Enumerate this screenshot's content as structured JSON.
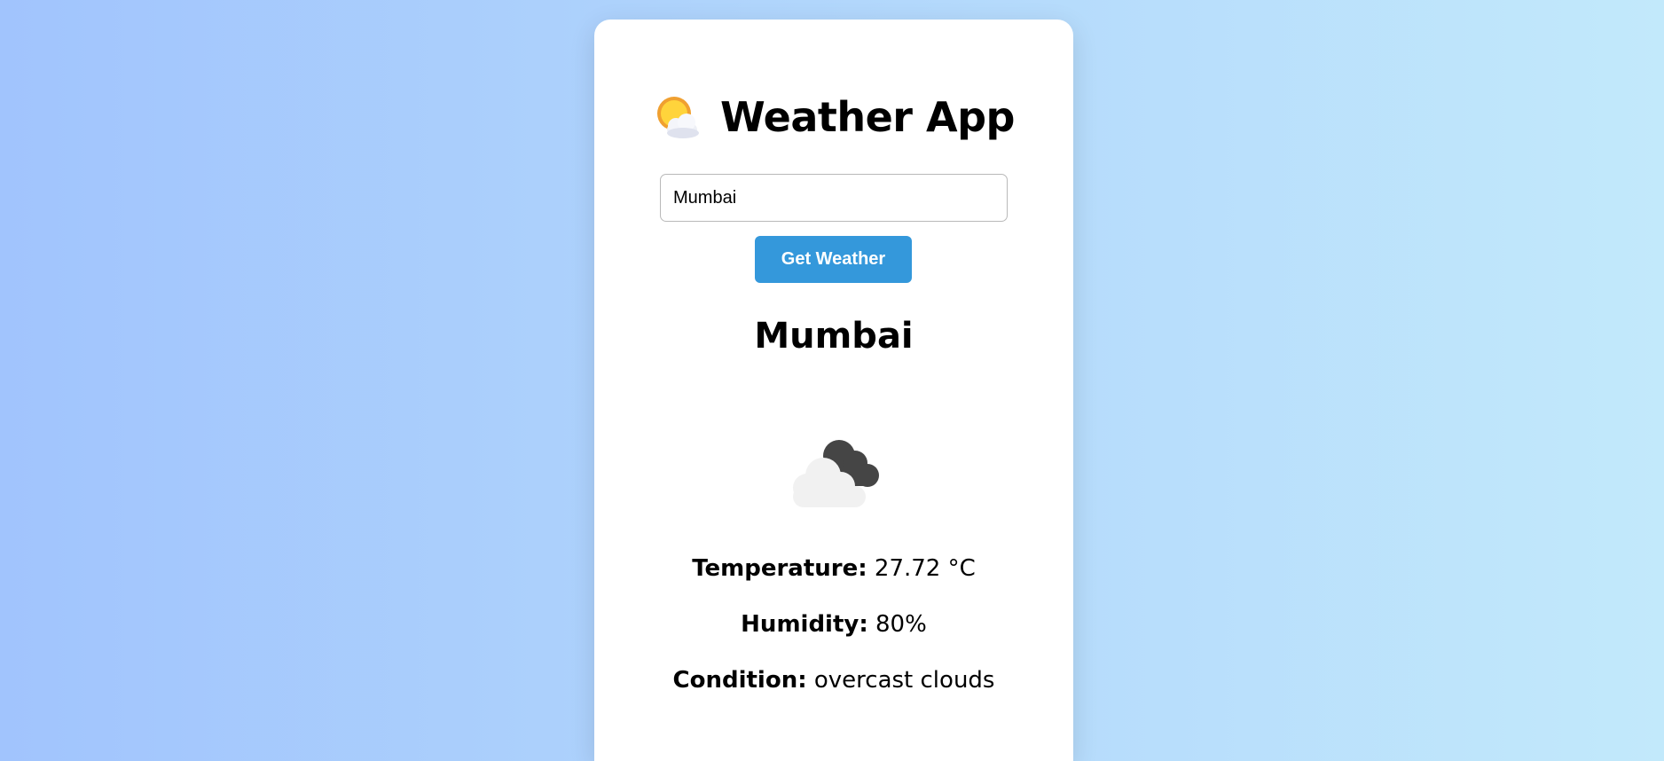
{
  "header": {
    "title": "Weather App",
    "title_icon": "sun-behind-cloud-icon"
  },
  "search": {
    "value": "Mumbai",
    "button_label": "Get Weather"
  },
  "result": {
    "city": "Mumbai",
    "weather_icon": "overcast-clouds-icon",
    "temperature_label": "Temperature:",
    "temperature_value": "27.72 °C",
    "humidity_label": "Humidity:",
    "humidity_value": "80%",
    "condition_label": "Condition:",
    "condition_value": "overcast clouds"
  },
  "colors": {
    "background_start": "#a1c4fd",
    "background_end": "#c2e9fb",
    "button": "#3498db"
  }
}
